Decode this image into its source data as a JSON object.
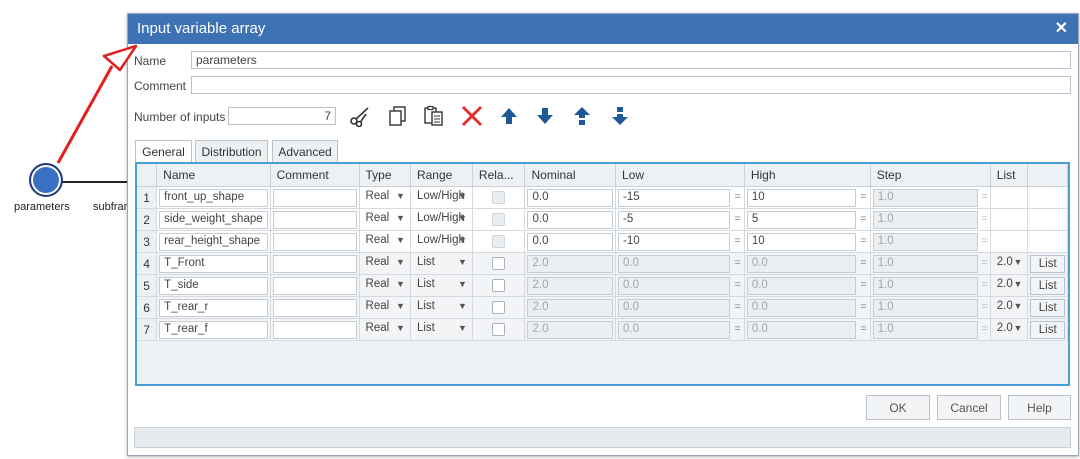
{
  "background": {
    "node_label": "parameters",
    "node2_label": "subframe"
  },
  "dialog": {
    "title": "Input variable array",
    "close_glyph": "✕",
    "name_label": "Name",
    "name_value": "parameters",
    "comment_label": "Comment",
    "comment_value": "",
    "num_inputs_label": "Number of inputs",
    "num_inputs_value": "7",
    "toolbar": [
      "cut-icon",
      "copy-icon",
      "paste-icon",
      "delete-icon",
      "move-up-icon",
      "move-down-icon",
      "move-top-icon",
      "move-bottom-icon"
    ],
    "tabs": [
      {
        "label": "General",
        "active": true
      },
      {
        "label": "Distribution",
        "active": false
      },
      {
        "label": "Advanced",
        "active": false
      }
    ],
    "table": {
      "headers": [
        "Name",
        "Comment",
        "Type",
        "Range",
        "Rela...",
        "Nominal",
        "Low",
        "High",
        "Step",
        "List"
      ],
      "rows": [
        {
          "num": "1",
          "name": "front_up_shape",
          "comment": "",
          "type": "Real",
          "range": "Low/High",
          "rel_disabled": true,
          "nominal": "0.0",
          "low": "-15",
          "high": "10",
          "step": "1.0",
          "list_val": "",
          "list_btn": "",
          "grey": false
        },
        {
          "num": "2",
          "name": "side_weight_shape",
          "comment": "",
          "type": "Real",
          "range": "Low/High",
          "rel_disabled": true,
          "nominal": "0.0",
          "low": "-5",
          "high": "5",
          "step": "1.0",
          "list_val": "",
          "list_btn": "",
          "grey": false
        },
        {
          "num": "3",
          "name": "rear_height_shape",
          "comment": "",
          "type": "Real",
          "range": "Low/High",
          "rel_disabled": true,
          "nominal": "0.0",
          "low": "-10",
          "high": "10",
          "step": "1.0",
          "list_val": "",
          "list_btn": "",
          "grey": false
        },
        {
          "num": "4",
          "name": "T_Front",
          "comment": "",
          "type": "Real",
          "range": "List",
          "rel_disabled": false,
          "nominal": "2.0",
          "low": "0.0",
          "high": "0.0",
          "step": "1.0",
          "list_val": "2.0",
          "list_btn": "List",
          "grey": true
        },
        {
          "num": "5",
          "name": "T_side",
          "comment": "",
          "type": "Real",
          "range": "List",
          "rel_disabled": false,
          "nominal": "2.0",
          "low": "0.0",
          "high": "0.0",
          "step": "1.0",
          "list_val": "2.0",
          "list_btn": "List",
          "grey": true
        },
        {
          "num": "6",
          "name": "T_rear_r",
          "comment": "",
          "type": "Real",
          "range": "List",
          "rel_disabled": false,
          "nominal": "2.0",
          "low": "0.0",
          "high": "0.0",
          "step": "1.0",
          "list_val": "2.0",
          "list_btn": "List",
          "grey": true
        },
        {
          "num": "7",
          "name": "T_rear_f",
          "comment": "",
          "type": "Real",
          "range": "List",
          "rel_disabled": false,
          "nominal": "2.0",
          "low": "0.0",
          "high": "0.0",
          "step": "1.0",
          "list_val": "2.0",
          "list_btn": "List",
          "grey": true
        }
      ]
    },
    "buttons": {
      "ok": "OK",
      "cancel": "Cancel",
      "help": "Help"
    }
  },
  "colors": {
    "titlebar": "#3d73b5",
    "grid_border": "#4a9fd8",
    "delete_red": "#e23030",
    "arrow_blue": "#1f5a96",
    "annotation_red": "#e02020"
  }
}
